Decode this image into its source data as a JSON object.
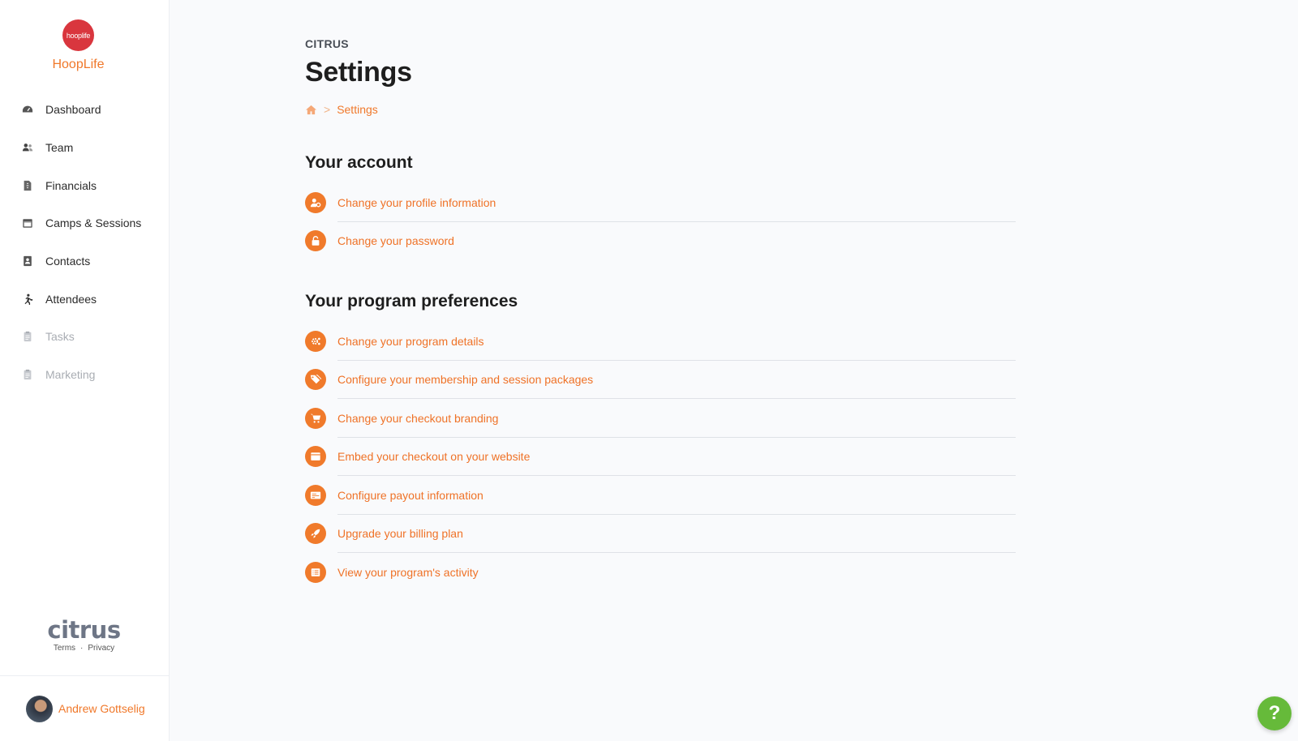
{
  "brand": {
    "logo_text": "hooplife",
    "name": "HoopLife"
  },
  "sidebar": {
    "items": [
      {
        "label": "Dashboard",
        "icon": "dashboard-icon",
        "enabled": true
      },
      {
        "label": "Team",
        "icon": "team-icon",
        "enabled": true
      },
      {
        "label": "Financials",
        "icon": "financials-icon",
        "enabled": true
      },
      {
        "label": "Camps & Sessions",
        "icon": "calendar-icon",
        "enabled": true
      },
      {
        "label": "Contacts",
        "icon": "contacts-icon",
        "enabled": true
      },
      {
        "label": "Attendees",
        "icon": "attendees-icon",
        "enabled": true
      },
      {
        "label": "Tasks",
        "icon": "clipboard-icon",
        "enabled": false
      },
      {
        "label": "Marketing",
        "icon": "clipboard-icon",
        "enabled": false
      }
    ],
    "footer": {
      "logo": "citrus",
      "terms": "Terms",
      "separator": "·",
      "privacy": "Privacy"
    },
    "user": {
      "name": "Andrew Gottselig"
    }
  },
  "header": {
    "eyebrow": "CITRUS",
    "title": "Settings",
    "breadcrumb": {
      "home_icon": "home-icon",
      "separator": ">",
      "current": "Settings"
    }
  },
  "sections": {
    "account": {
      "title": "Your account",
      "items": [
        {
          "label": "Change your profile information",
          "icon": "user-cog-icon"
        },
        {
          "label": "Change your password",
          "icon": "lock-icon"
        }
      ]
    },
    "program": {
      "title": "Your program preferences",
      "items": [
        {
          "label": "Change your program details",
          "icon": "cogs-icon"
        },
        {
          "label": "Configure your membership and session packages",
          "icon": "tags-icon"
        },
        {
          "label": "Change your checkout branding",
          "icon": "cart-icon"
        },
        {
          "label": "Embed your checkout on your website",
          "icon": "window-icon"
        },
        {
          "label": "Configure payout information",
          "icon": "money-check-icon"
        },
        {
          "label": "Upgrade your billing plan",
          "icon": "rocket-icon"
        },
        {
          "label": "View your program's activity",
          "icon": "list-icon"
        }
      ]
    }
  },
  "help": {
    "label": "?"
  },
  "colors": {
    "accent": "#f07a2b",
    "help": "#66ba3a",
    "brand_red": "#d9363e"
  }
}
